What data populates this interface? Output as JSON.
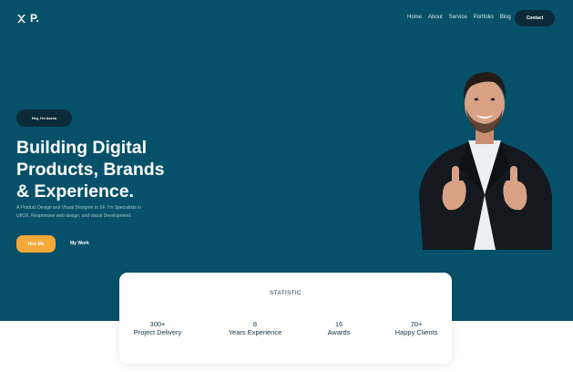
{
  "brand": {
    "name": "P."
  },
  "nav": {
    "items": [
      "Home",
      "About",
      "Service",
      "Portfolio",
      "Blog"
    ],
    "contact_label": "Contact"
  },
  "hero": {
    "pill": "Hey, I'm Aaron",
    "headline_lines": [
      "Building Digital",
      "Products, Brands",
      "& Experience."
    ],
    "sub_lines": [
      "A Product Design and Visual Designer in SF. I'm Specialists in",
      "UI/UX, Responsive web design, and visual Development."
    ],
    "hire_label": "Hire Me",
    "work_label": "My Work"
  },
  "statistic": {
    "title": "STATISTIC",
    "items": [
      {
        "value": "300+",
        "label": "Project Delivery"
      },
      {
        "value": "8",
        "label": "Years Experience"
      },
      {
        "value": "16",
        "label": "Awards"
      },
      {
        "value": "70+",
        "label": "Happy Clients"
      }
    ]
  },
  "colors": {
    "hero_bg": "#075069",
    "accent": "#f4a93b",
    "dark": "#0b2a3a"
  }
}
